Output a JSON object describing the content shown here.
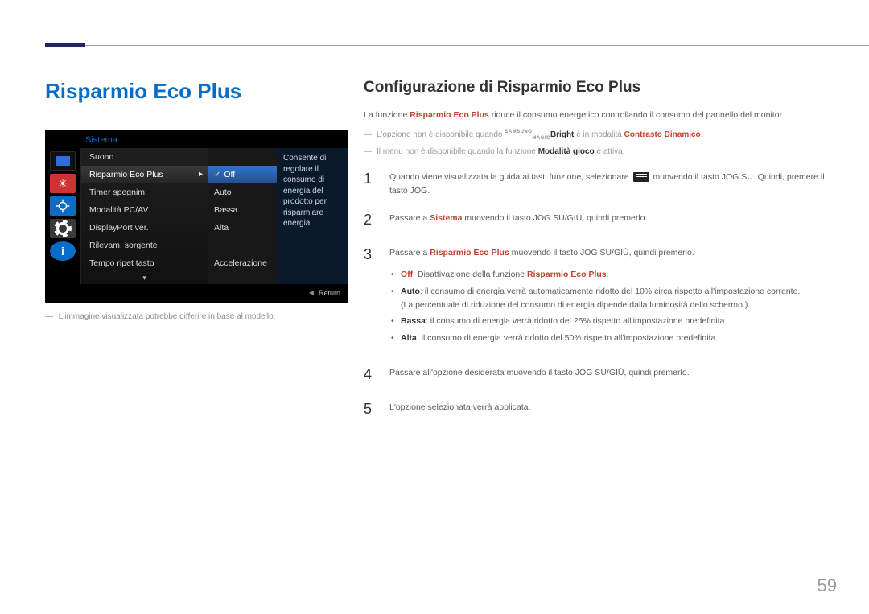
{
  "page_title": "Risparmio Eco Plus",
  "osd": {
    "header": "Sistema",
    "rows": [
      "Suono",
      "Risparmio Eco Plus",
      "Timer spegnim.",
      "Modalità PC/AV",
      "DisplayPort ver.",
      "Rilevam. sorgente",
      "Tempo ripet tasto"
    ],
    "selected_index": 1,
    "values": [
      "",
      "Off",
      "Auto",
      "Bassa",
      "Alta",
      "",
      "Accelerazione"
    ],
    "value_selected_index": 1,
    "desc": "Consente di regolare il consumo di energia del prodotto per risparmiare energia.",
    "return_label": "Return"
  },
  "footnote": "L'immagine visualizzata potrebbe differire in base al modello.",
  "section_title": "Configurazione di Risparmio Eco Plus",
  "intro": {
    "pre": "La funzione ",
    "em": "Risparmio Eco Plus",
    "post": " riduce il consumo energetico controllando il consumo del pannello del monitor."
  },
  "note1": {
    "pre": "L'opzione non è disponibile quando ",
    "magic_s": "SAMSUNG",
    "magic_m": "MAGIC",
    "bright": "Bright",
    "mid": " è in modalità ",
    "em": "Contrasto Dinamico",
    "post": "."
  },
  "note2": {
    "pre": "Il menu non è disponibile quando la funzione ",
    "em": "Modalità gioco",
    "post": " è attiva."
  },
  "steps": {
    "s1a": "Quando viene visualizzata la guida ai tasti funzione, selezionare ",
    "s1b": " muovendo il tasto JOG SU. Quindi, premere il tasto JOG.",
    "s2a": "Passare a ",
    "s2em": "Sistema",
    "s2b": " muovendo il tasto JOG SU/GIÙ, quindi premerlo.",
    "s3a": "Passare a ",
    "s3em": "Risparmio Eco Plus",
    "s3b": " muovendo il tasto JOG SU/GIÙ, quindi premerlo.",
    "s4": "Passare all'opzione desiderata muovendo il tasto JOG SU/GIÙ, quindi premerlo.",
    "s5": "L'opzione selezionata verrà applicata."
  },
  "bullets": {
    "off_label": "Off",
    "off_txt": ": Disattivazione della funzione ",
    "off_em": "Risparmio Eco Plus",
    "off_post": ".",
    "auto_label": "Auto",
    "auto_txt": ": il consumo di energia verrà automaticamente ridotto del 10% circa rispetto all'impostazione corrente.",
    "auto_sub": "(La percentuale di riduzione del consumo di energia dipende dalla luminosità dello schermo.)",
    "bassa_label": "Bassa",
    "bassa_txt": ": il consumo di energia verrà ridotto del 25% rispetto all'impostazione predefinita.",
    "alta_label": "Alta",
    "alta_txt": ": il consumo di energia verrà ridotto del 50% rispetto all'impostazione predefinita."
  },
  "page_no": "59"
}
